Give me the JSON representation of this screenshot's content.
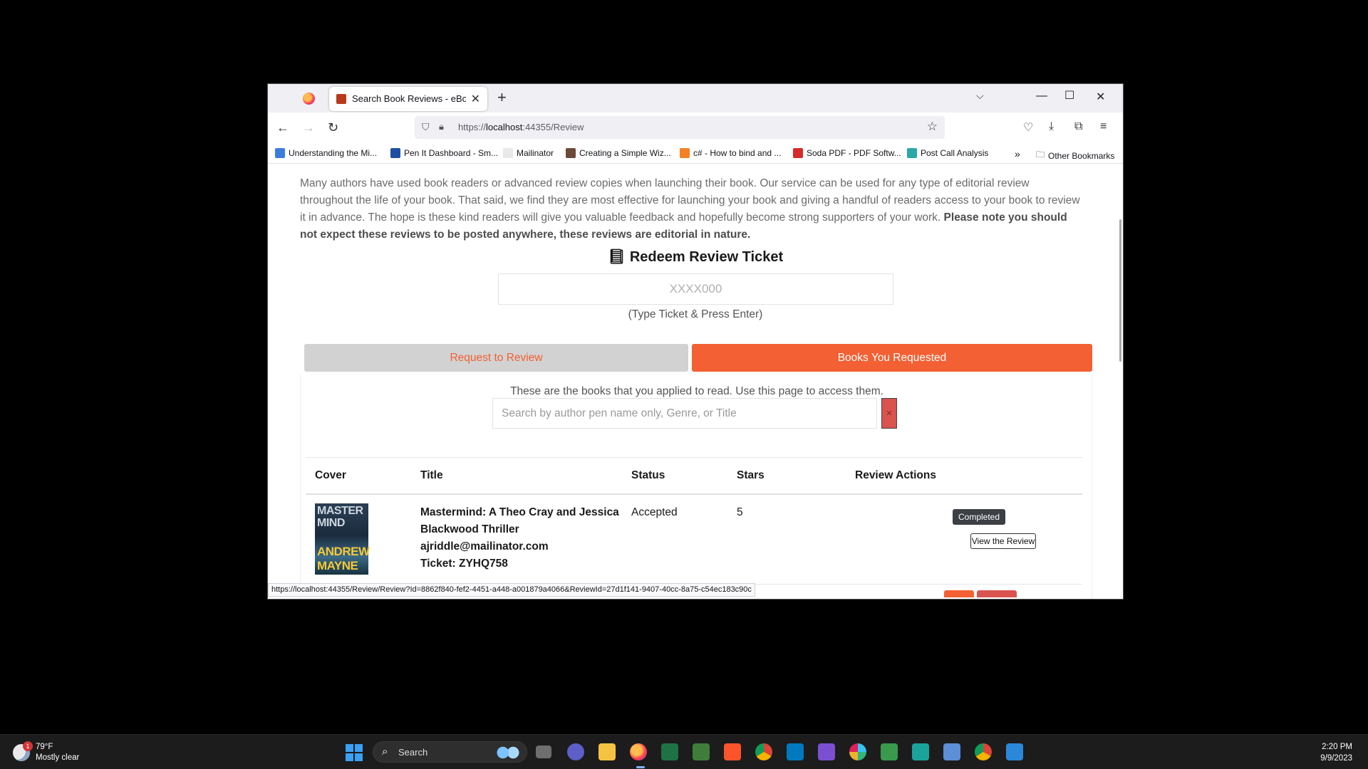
{
  "browser": {
    "tab_title": "Search Book Reviews - eBookFa",
    "url_prefix": "https://",
    "url_host": "localhost",
    "url_rest": ":44355/Review",
    "bookmarks": [
      {
        "label": "Understanding the Mi...",
        "color": "#3b7ddd"
      },
      {
        "label": "Pen It Dashboard - Sm...",
        "color": "#1e4fa3"
      },
      {
        "label": "Mailinator",
        "color": "#e9e9e9"
      },
      {
        "label": "Creating a Simple Wiz...",
        "color": "#6b4a3a"
      },
      {
        "label": "c# - How to bind and ...",
        "color": "#f48024"
      },
      {
        "label": "Soda PDF - PDF Softw...",
        "color": "#d62b2b"
      },
      {
        "label": "Post Call Analysis",
        "color": "#2aa8a8"
      }
    ],
    "other_bookmarks": "Other Bookmarks",
    "status_url": "https://localhost:44355/Review/Review?Id=8862f840-fef2-4451-a448-a001879a4066&ReviewId=27d1f141-9407-40cc-8a75-c54ec183c90c"
  },
  "page": {
    "intro_text": "Many authors have used book readers or advanced review copies when launching their book. Our service can be used for any type of editorial review throughout the life of your book. That said, we find they are most effective for launching your book and giving a handful of readers access to your book to review it in advance. The hope is these kind readers will give you valuable feedback and hopefully become strong supporters of your work. ",
    "intro_bold": "Please note you should not expect these reviews to be posted anywhere, these reviews are editorial in nature.",
    "redeem_heading": "Redeem Review Ticket",
    "ticket_placeholder": "XXXX000",
    "ticket_hint": "(Type Ticket & Press Enter)",
    "tab_request": "Request to Review",
    "tab_requested": "Books You Requested",
    "panel_desc": "These are the books that you applied to read. Use this page to access them.",
    "search_placeholder": "Search by author pen name only, Genre, or Title",
    "clear_label": "×",
    "table": {
      "headers": [
        "Cover",
        "Title",
        "Status",
        "Stars",
        "Review Actions"
      ],
      "rows": [
        {
          "cover_title": "MASTER MIND",
          "cover_author": "ANDREW MAYNE",
          "title": "Mastermind: A Theo Cray and Jessica Blackwood Thriller",
          "email": "ajriddle@mailinator.com",
          "ticket": "Ticket: ZYHQ758",
          "status": "Accepted",
          "stars": "5",
          "badge": "Completed",
          "action": "View the Review"
        }
      ]
    }
  },
  "taskbar": {
    "temperature": "79°F",
    "weather": "Mostly clear",
    "weather_badge": "1",
    "search_label": "Search",
    "time": "2:20 PM",
    "date": "9/9/2023"
  },
  "colors": {
    "accent": "#f26033",
    "tab_inactive": "#d2d2d2",
    "danger": "#d9534f"
  }
}
